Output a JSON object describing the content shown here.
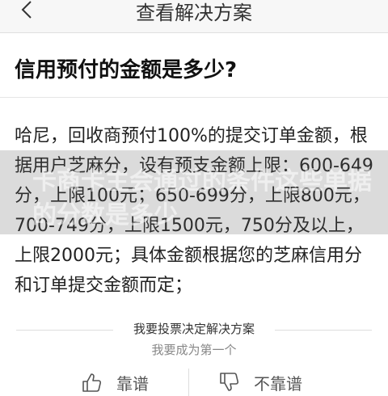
{
  "header": {
    "title": "查看解决方案"
  },
  "question": "信用预付的金额是多少?",
  "answer": "哈尼，回收商预付100%的提交订单金额，根据用户芝麻分，设有预支金额上限：600-649分，上限100元；650-699分，上限800元，700-749分，上限1500元，750分及以上，上限2000元；具体金额根据您的芝麻信用分和订单提交金额而定；",
  "watermark_text": "卡商卡主会通过的条件这些单据的分数是多少",
  "vote": {
    "title": "我要投票决定解决方案",
    "subtitle": "我要成为第一个",
    "like_label": "靠谱",
    "dislike_label": "不靠谱"
  }
}
